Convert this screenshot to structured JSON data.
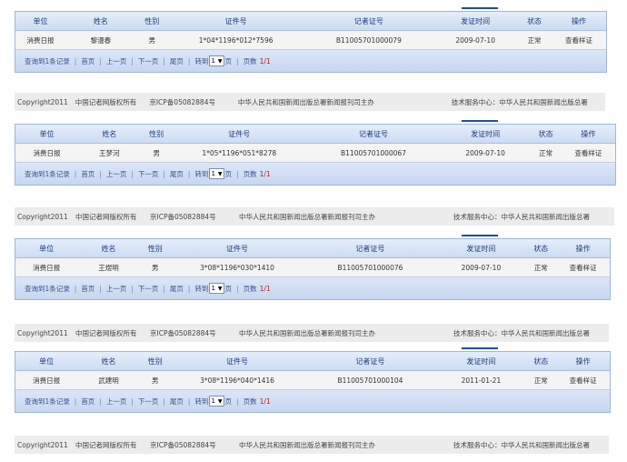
{
  "columns": {
    "unit": "单位",
    "name": "姓名",
    "gender": "性别",
    "id_number": "证件号",
    "press_card": "记者证号",
    "issue_date": "发证时间",
    "status": "状态",
    "action": "操作"
  },
  "records": [
    {
      "unit": "消费日报",
      "name": "黎漫春",
      "gender": "男",
      "id_number": "1*04*1196*012*7596",
      "press_card": "B11005701000079",
      "issue_date": "2009-07-10",
      "status": "正常",
      "action": "查看样证"
    },
    {
      "unit": "消费日报",
      "name": "王梦河",
      "gender": "男",
      "id_number": "1*05*1196*051*8278",
      "press_card": "B11005701000067",
      "issue_date": "2009-07-10",
      "status": "正常",
      "action": "查看样证"
    },
    {
      "unit": "消费日报",
      "name": "王煜明",
      "gender": "男",
      "id_number": "3*08*1196*030*1410",
      "press_card": "B11005701000076",
      "issue_date": "2009-07-10",
      "status": "正常",
      "action": "查看样证"
    },
    {
      "unit": "消费日报",
      "name": "武建明",
      "gender": "男",
      "id_number": "3*08*1196*040*1416",
      "press_card": "B11005701000104",
      "issue_date": "2011-01-21",
      "status": "正常",
      "action": "查看样证"
    }
  ],
  "pager": {
    "summary": "查询到1条记录",
    "first": "首页",
    "prev": "上一页",
    "next": "下一页",
    "last": "尾页",
    "goto_prefix": "转到",
    "goto_value": "1",
    "goto_suffix": "页",
    "page_count_label": "页数",
    "page_count": "1/1",
    "separator": "|"
  },
  "footer": {
    "copyright": "Copyright2011",
    "owner": "中国记者网版权所有",
    "icp": "京ICP备05082884号",
    "sponsor": "中华人民共和国新闻出版总署新闻报刊司主办",
    "tech_support": "技术服务中心：中华人民共和国新闻出版总署"
  },
  "colors": {
    "header_text": "#1b3c7a",
    "pager_bg": "#c6d7f0",
    "page_count": "#b01c1c",
    "border": "#9fb6d6"
  }
}
